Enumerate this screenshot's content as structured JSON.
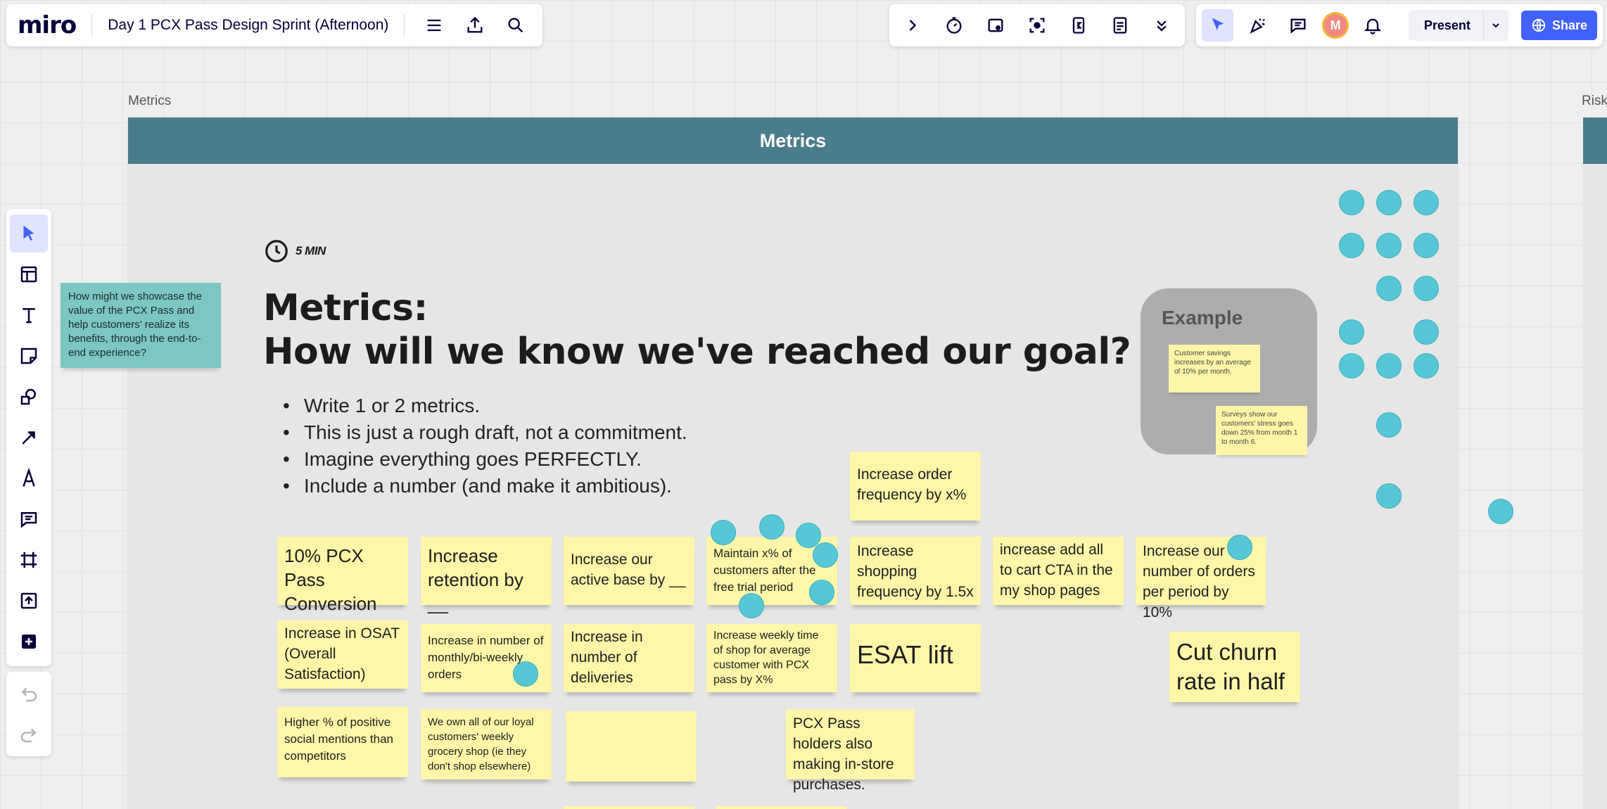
{
  "app": {
    "logo": "miro",
    "board_title": "Day 1 PCX Pass Design Sprint (Afternoon)"
  },
  "topbar_right": {
    "avatar_initial": "M",
    "present_label": "Present",
    "share_label": "Share"
  },
  "frame": {
    "label": "Metrics",
    "header": "Metrics",
    "next_frame_label": "Risk"
  },
  "content": {
    "timer": "5 MIN",
    "heading_line1": "Metrics:",
    "heading_line2": "How will we know we've reached our goal?",
    "bullets": [
      "Write 1 or 2 metrics.",
      "This is just a rough draft, not a commitment.",
      "Imagine everything goes PERFECTLY.",
      "Include a number (and make it ambitious)."
    ]
  },
  "prompt_note": "How might we showcase the value of the PCX Pass and help customers' realize its benefits, through the end-to-end experience?",
  "example": {
    "title": "Example",
    "note1": "Customer savings increases by an average of 10% per month.",
    "note2": "Surveys show our customers' stress goes down 25% from month 1 to month 6."
  },
  "notes": {
    "n1": "10% PCX Pass Conversion",
    "n2": "Increase retention by __",
    "n3": "Increase our active base by __",
    "n4": "Maintain x% of customers after the free trial period",
    "n5": "Increase order frequency by x%",
    "n6": "Increase shopping frequency by 1.5x",
    "n7": "increase add all to cart CTA in the my shop pages",
    "n8": "Increase our number of orders per period by 10%",
    "n9": "Increase in OSAT (Overall Satisfaction)",
    "n10": "Increase in number of monthly/bi-weekly orders",
    "n11": "Increase in number of deliveries",
    "n12": "Increase weekly time of shop for average customer with PCX pass by X%",
    "n13": "ESAT lift",
    "n14": "Cut churn rate in half",
    "n15": "Higher % of positive social mentions than competitors",
    "n16": "We own all of our loyal customers' weekly grocery shop (ie they don't shop elsewhere)",
    "n17": "",
    "n18": "PCX Pass holders also making in-store purchases."
  },
  "colors": {
    "frame_header": "#4b7c8c",
    "sticky_yellow": "#fef6a9",
    "sticky_teal": "#7cc6c4",
    "vote_dot": "#56c7d5",
    "accent_blue": "#4262ff"
  }
}
